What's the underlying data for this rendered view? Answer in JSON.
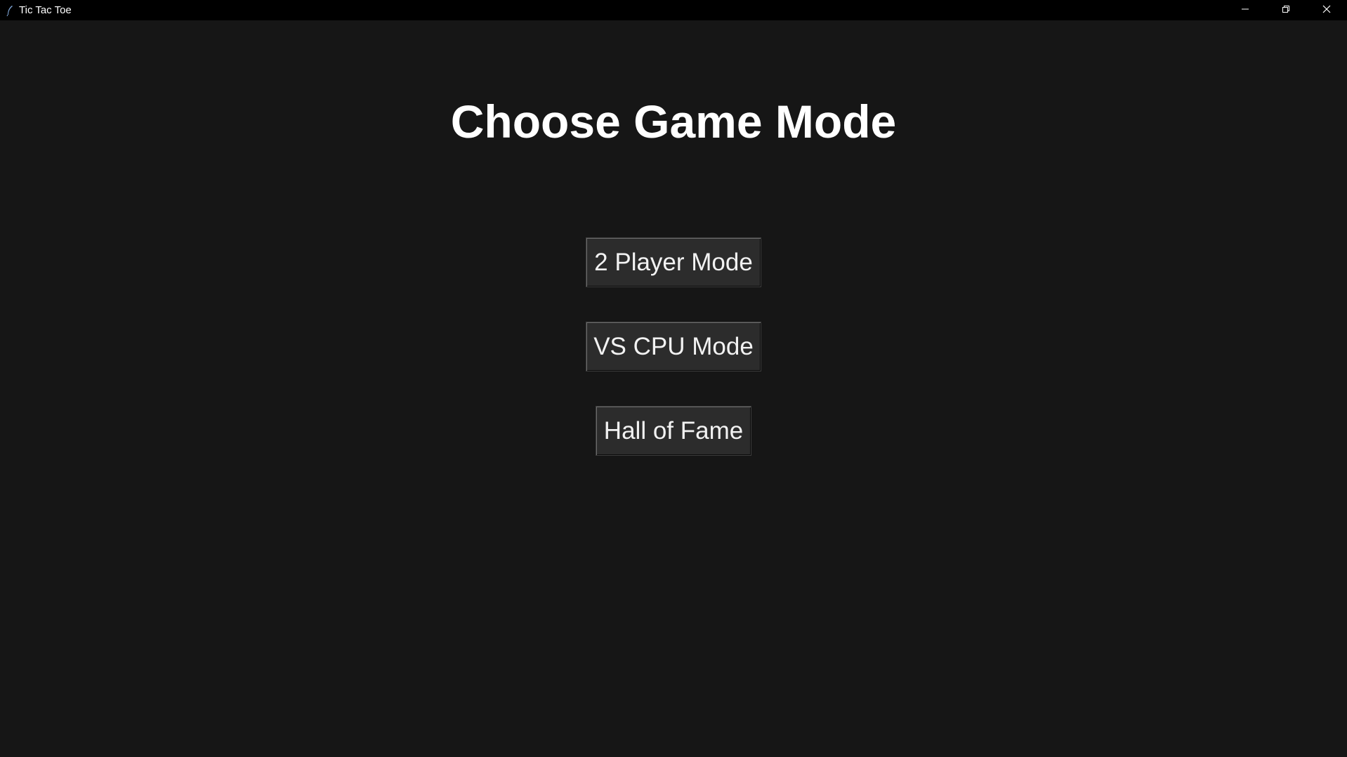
{
  "window": {
    "title": "Tic Tac Toe",
    "icon": "feather-icon",
    "controls": [
      "minimize-icon",
      "restore-icon",
      "close-icon"
    ]
  },
  "main": {
    "heading": "Choose Game Mode",
    "buttons": [
      {
        "label": "2 Player Mode"
      },
      {
        "label": "VS CPU Mode"
      },
      {
        "label": "Hall of Fame"
      }
    ]
  },
  "colors": {
    "background": "#161616",
    "titlebar": "#000000",
    "button": "#2c2c2c",
    "text": "#ffffff"
  }
}
